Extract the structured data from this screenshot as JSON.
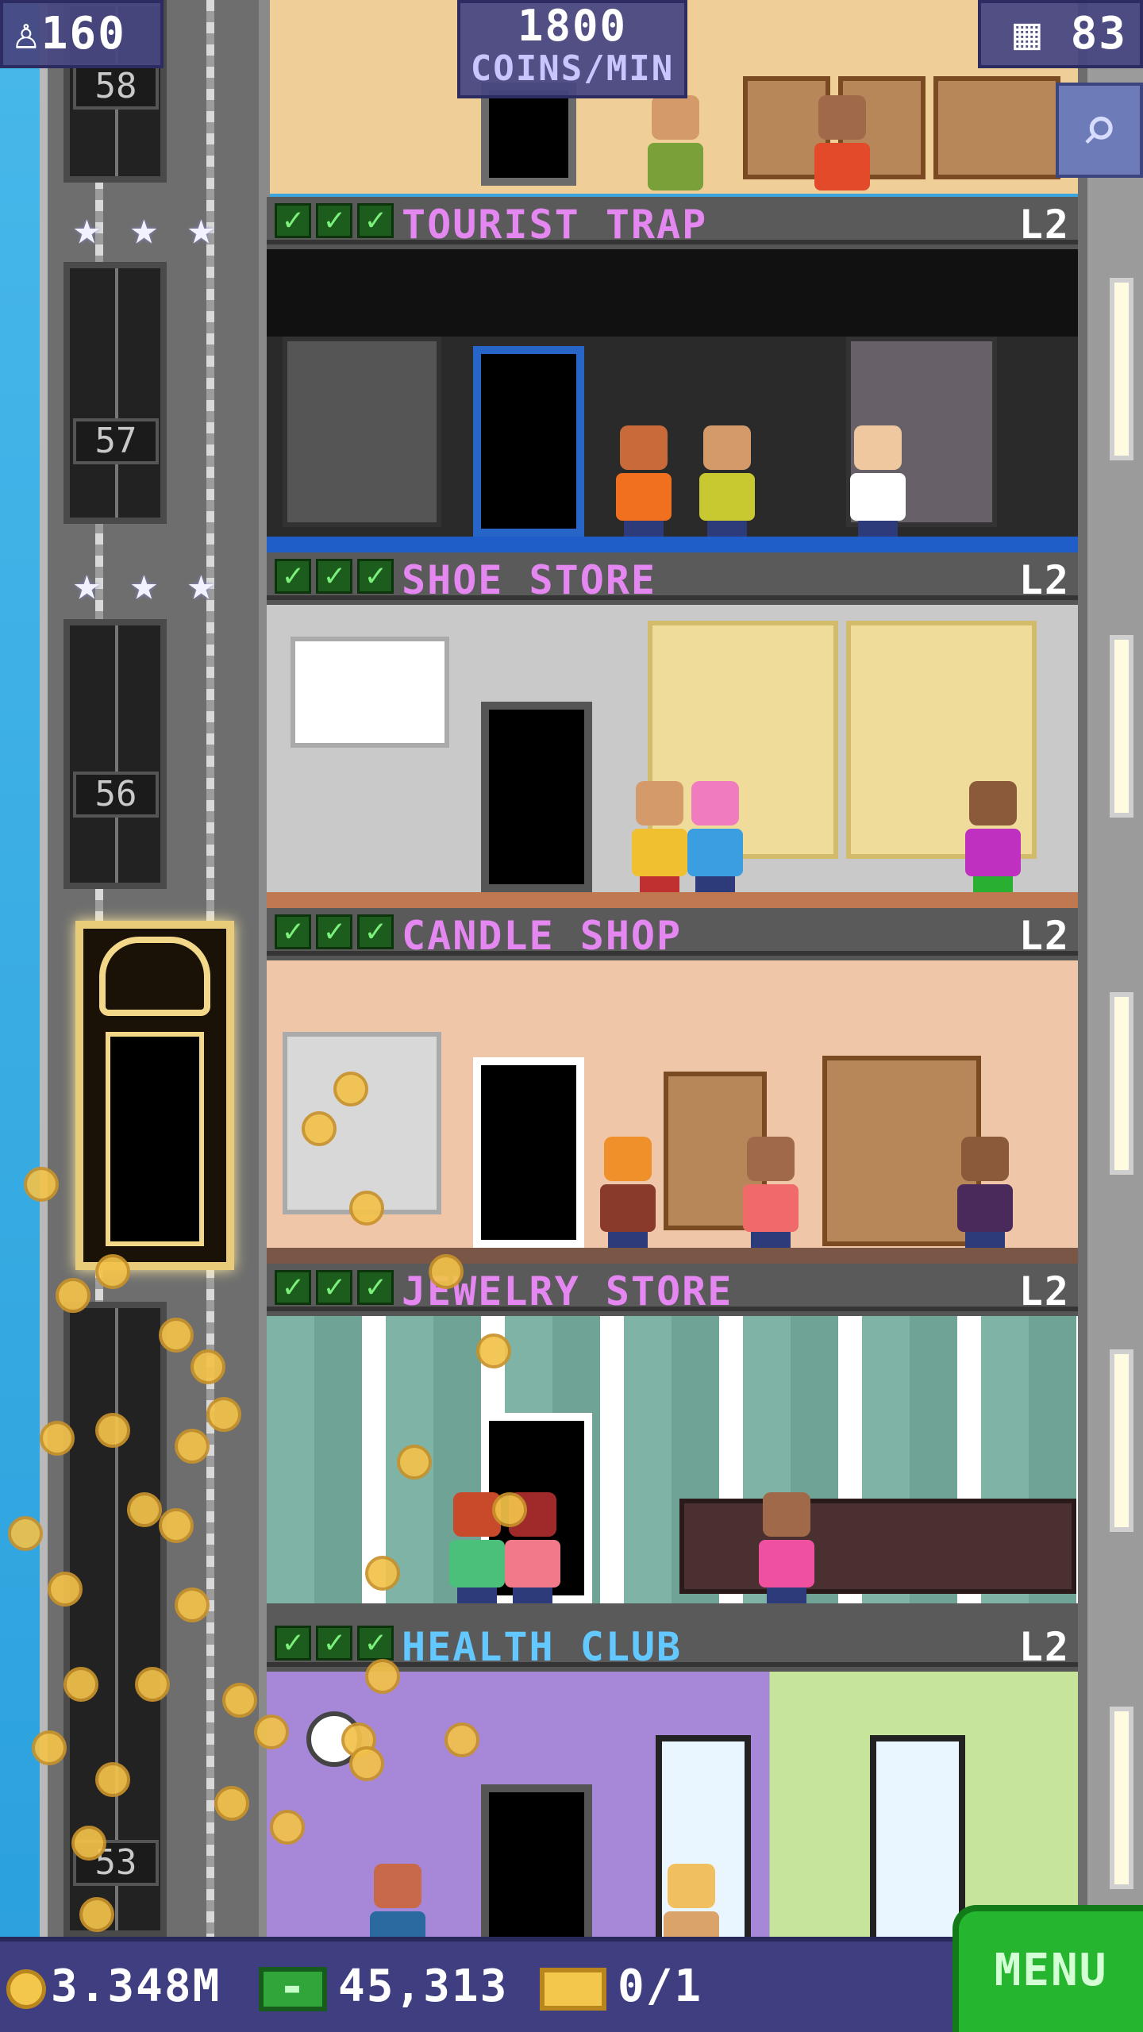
{
  "hud": {
    "population": "160",
    "coins_rate_value": "1800",
    "coins_rate_unit": "COINS/MIN",
    "floors": "83"
  },
  "elevator": {
    "floor_numbers": [
      "58",
      "57",
      "56",
      "53"
    ]
  },
  "floors": [
    {
      "name": "TOURIST TRAP",
      "level": "L2",
      "name_color": "#e487f0"
    },
    {
      "name": "SHOE STORE",
      "level": "L2",
      "name_color": "#e487f0"
    },
    {
      "name": "CANDLE SHOP",
      "level": "L2",
      "name_color": "#e487f0"
    },
    {
      "name": "JEWELRY STORE",
      "level": "L2",
      "name_color": "#e487f0"
    },
    {
      "name": "HEALTH CLUB",
      "level": "L2",
      "name_color": "#63c8ff"
    }
  ],
  "bottom": {
    "coins": "3.348M",
    "bux": "45,313",
    "vip": "0/1",
    "menu_label": "MENU"
  },
  "colors": {
    "hud_bg": "#48487e",
    "menu_green": "#26b52f",
    "retail_label": "#e487f0",
    "recreation_label": "#63c8ff"
  },
  "icons": [
    "person-icon",
    "building-icon",
    "search-icon",
    "coin-icon",
    "bux-icon",
    "vip-ticket-icon",
    "checkmark-icon",
    "star-icon"
  ]
}
